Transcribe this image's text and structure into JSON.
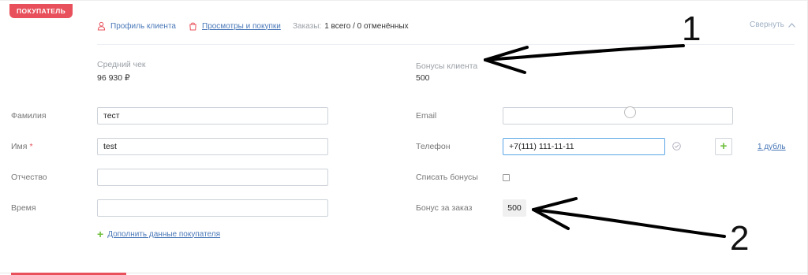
{
  "tag": "ПОКУПАТЕЛЬ",
  "header": {
    "profile_link": "Профиль клиента",
    "views_link": "Просмотры и покупки",
    "orders_label": "Заказы:",
    "orders_value": "1 всего / 0 отменённых",
    "collapse_label": "Свернуть"
  },
  "meta": {
    "avg_check_label": "Средний чек",
    "avg_check_value": "96 930 ₽",
    "bonus_label": "Бонусы клиента",
    "bonus_value": "500"
  },
  "left_form": {
    "surname_label": "Фамилия",
    "surname_value": "тест",
    "name_label": "Имя",
    "required_mark": "*",
    "name_value": "test",
    "patronymic_label": "Отчество",
    "patronymic_value": "",
    "time_label": "Время",
    "time_value": "",
    "add_more_link": "Дополнить данные покупателя"
  },
  "right_form": {
    "email_label": "Email",
    "email_value": "",
    "phone_label": "Телефон",
    "phone_value": "+7(111) 111-11-11",
    "duplicate_link": "1 дубль",
    "write_off_label": "Списать бонусы",
    "bonus_order_label": "Бонус за заказ",
    "bonus_order_value": "500"
  },
  "annotations": {
    "number_1": "1",
    "number_2": "2"
  },
  "colors": {
    "tag": "#e8505b",
    "link": "#4a78b8",
    "add_green": "#6fbf3e"
  }
}
